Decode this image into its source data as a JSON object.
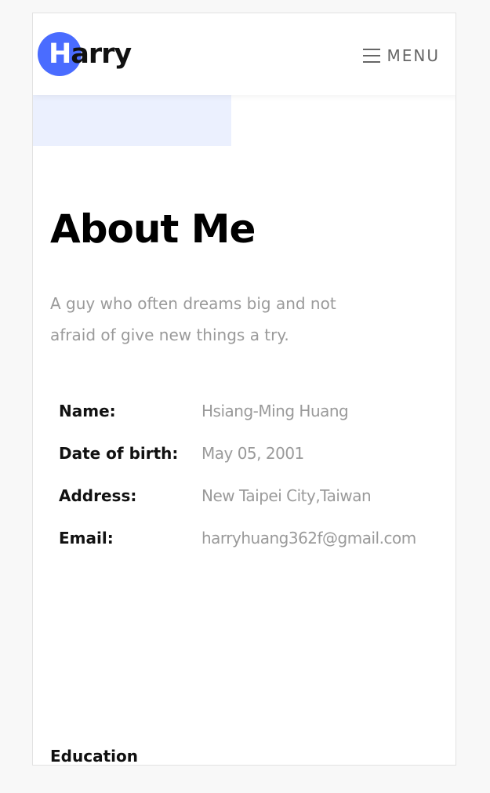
{
  "header": {
    "logo_first_letter": "H",
    "logo_rest": "arry",
    "menu_label": "MENU",
    "accent_color": "#4a6cff"
  },
  "about": {
    "title": "About Me",
    "intro_line1": "A guy who often dreams big and not",
    "intro_line2": "afraid of give new things a try.",
    "details": [
      {
        "label": "Name:",
        "value": "Hsiang-Ming Huang"
      },
      {
        "label": "Date of birth:",
        "value": "May 05, 2001"
      },
      {
        "label": "Address:",
        "value": "New Taipei City,Taiwan"
      },
      {
        "label": "Email:",
        "value": "harryhuang362f@gmail.com"
      }
    ]
  },
  "education": {
    "heading": "Education"
  }
}
